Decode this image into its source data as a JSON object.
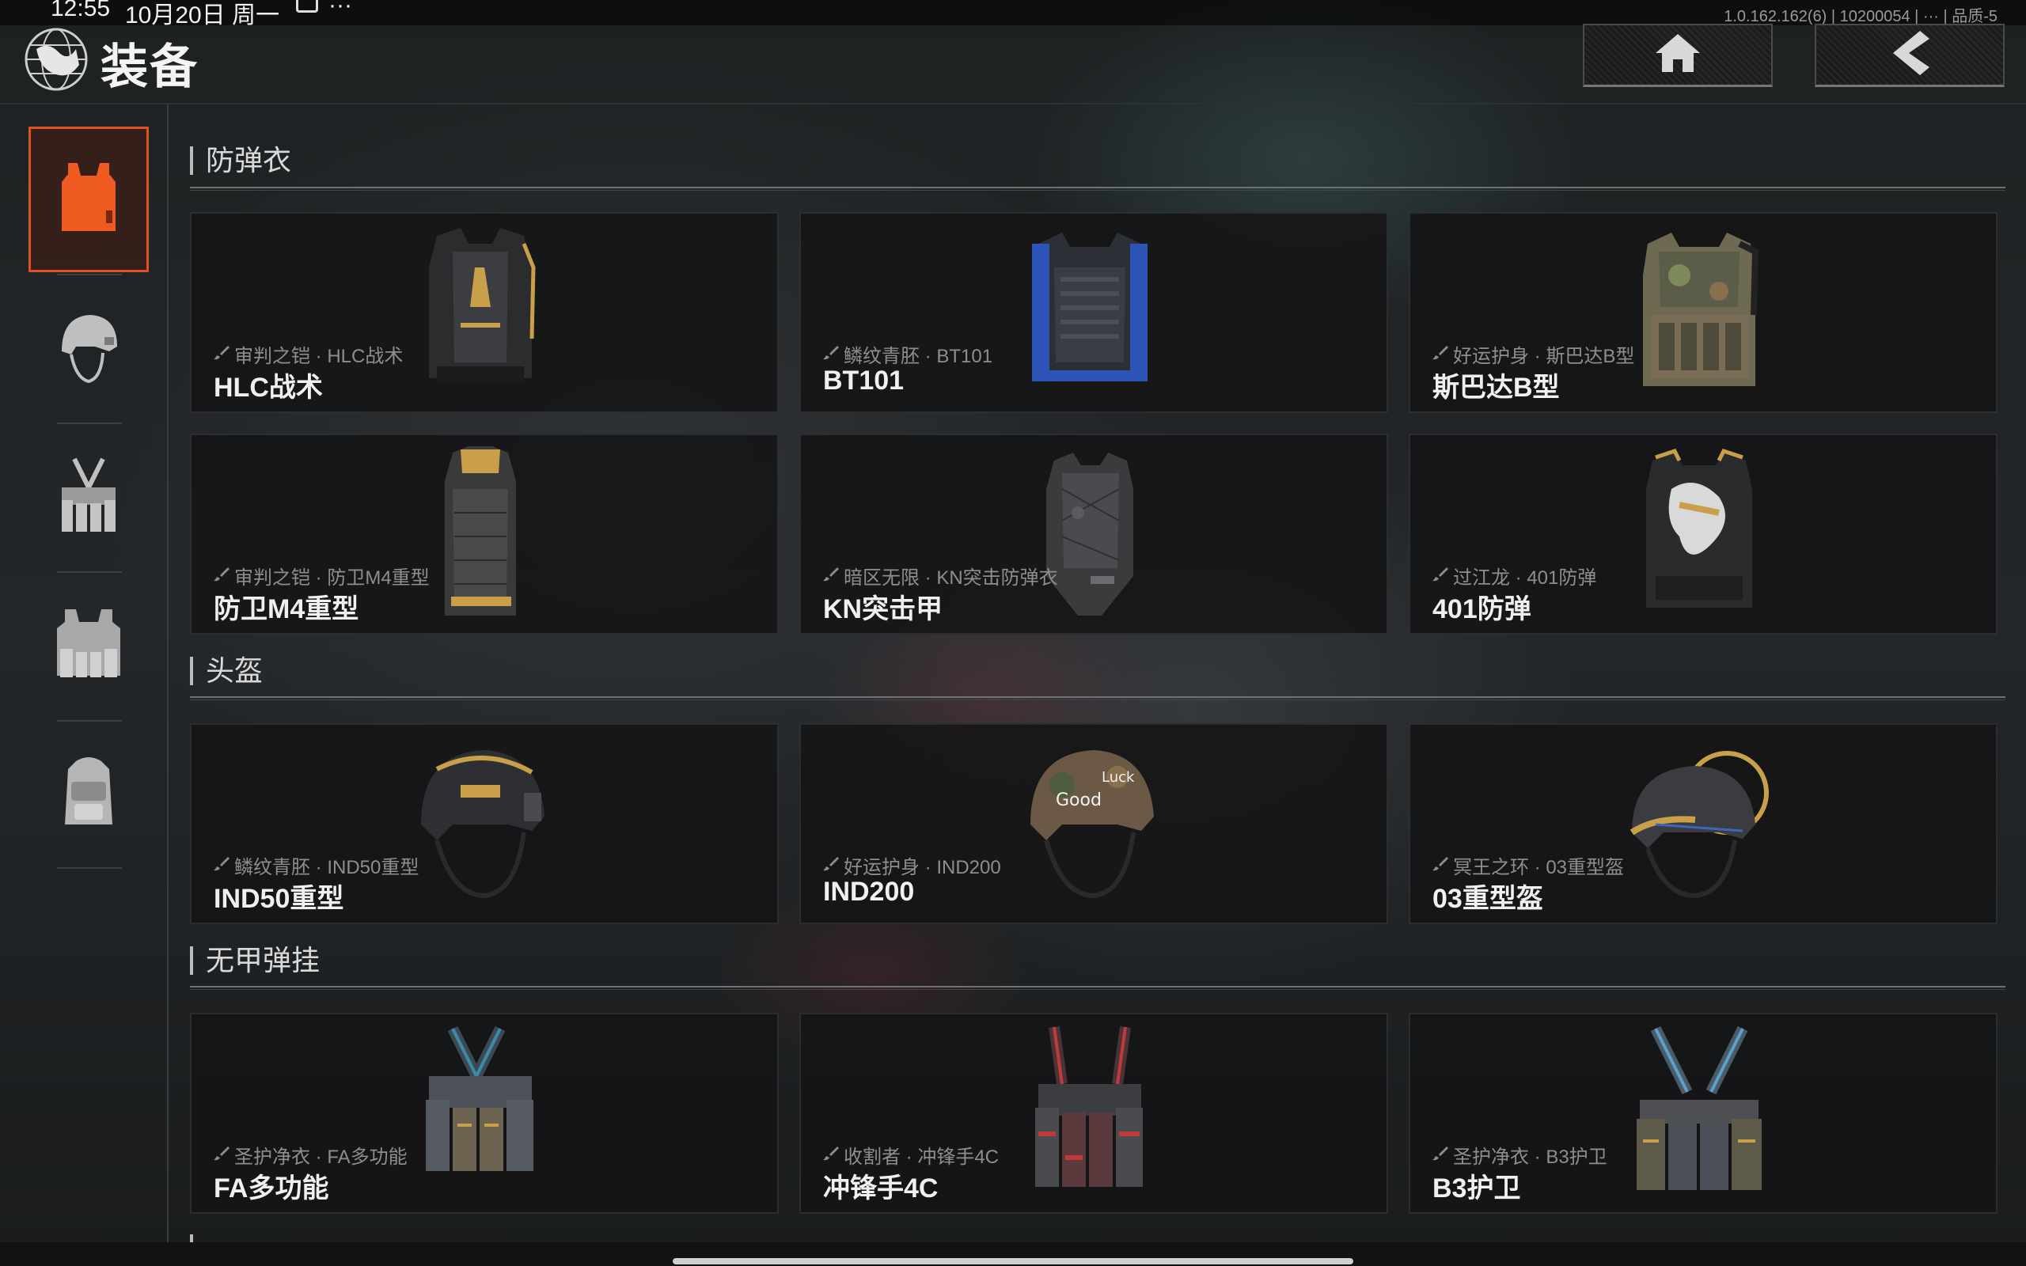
{
  "status_bar": {
    "time": "12:55",
    "date": "10月20日 周一",
    "more": "···",
    "version": "1.0.162.162(6) | 10200054 | ··· | 品质-5"
  },
  "header": {
    "title": "装备",
    "home_icon": "home-icon",
    "back_icon": "chevron-left-icon"
  },
  "sidebar": {
    "items": [
      {
        "icon": "body-armor-icon",
        "active": true
      },
      {
        "icon": "helmet-icon",
        "active": false
      },
      {
        "icon": "chest-rig-icon",
        "active": false
      },
      {
        "icon": "armored-rig-icon",
        "active": false
      },
      {
        "icon": "backpack-icon",
        "active": false
      }
    ]
  },
  "sections": [
    {
      "title": "防弹衣",
      "items": [
        {
          "skin": "审判之铠 · HLC战术",
          "name": "HLC战术"
        },
        {
          "skin": "鳞纹青胚 · BT101",
          "name": "BT101"
        },
        {
          "skin": "好运护身 · 斯巴达B型",
          "name": "斯巴达B型"
        },
        {
          "skin": "审判之铠 · 防卫M4重型",
          "name": "防卫M4重型"
        },
        {
          "skin": "暗区无限 · KN突击防弹衣",
          "name": "KN突击甲"
        },
        {
          "skin": "过江龙 · 401防弹",
          "name": "401防弹"
        }
      ]
    },
    {
      "title": "头盔",
      "items": [
        {
          "skin": "鳞纹青胚 · IND50重型",
          "name": "IND50重型"
        },
        {
          "skin": "好运护身 · IND200",
          "name": "IND200"
        },
        {
          "skin": "冥王之环 · 03重型盔",
          "name": "03重型盔"
        }
      ]
    },
    {
      "title": "无甲弹挂",
      "items": [
        {
          "skin": "圣护净衣 · FA多功能",
          "name": "FA多功能"
        },
        {
          "skin": "收割者 · 冲锋手4C",
          "name": "冲锋手4C"
        },
        {
          "skin": "圣护净衣 · B3护卫",
          "name": "B3护卫"
        }
      ]
    }
  ],
  "colors": {
    "accent": "#e0531c",
    "card_bg": "#151617",
    "text_primary": "#f0f0f0",
    "text_secondary": "#8e8e8e"
  }
}
